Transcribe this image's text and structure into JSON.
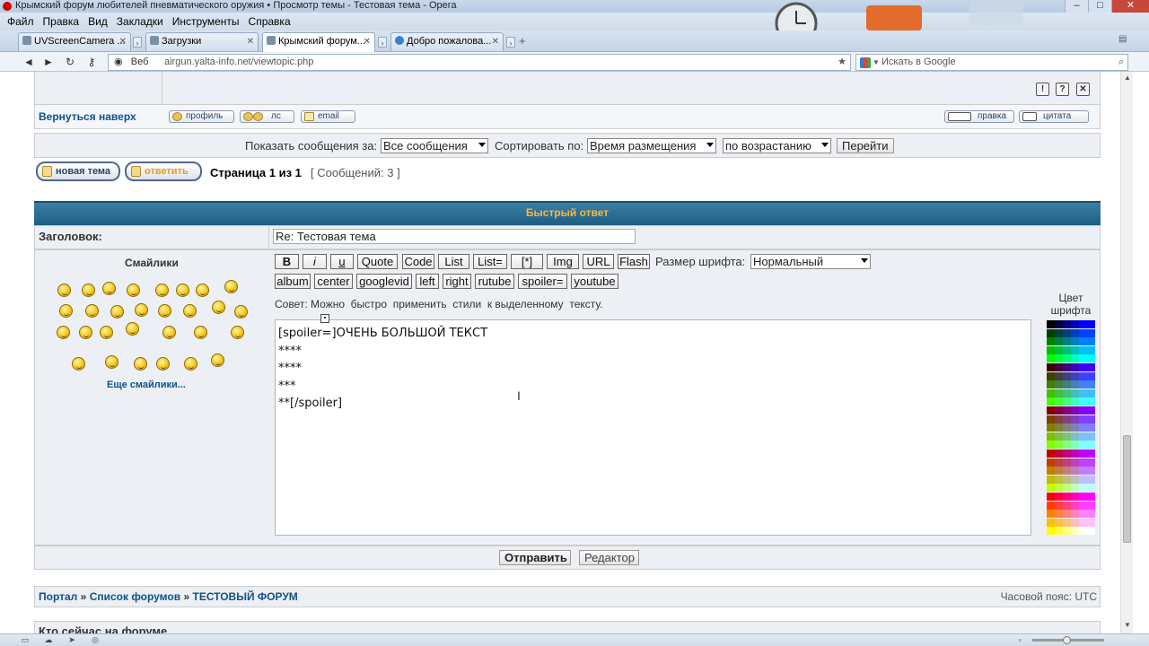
{
  "window": {
    "title": "Крымский форум любителей пневматического оружия • Просмотр темы - Тестовая тема - Opera",
    "controls": [
      "–",
      "□",
      "✕"
    ]
  },
  "menu": [
    "Файл",
    "Правка",
    "Вид",
    "Закладки",
    "Инструменты",
    "Справка"
  ],
  "tabs": [
    {
      "label": "UVScreenCamera ...",
      "active": false
    },
    {
      "label": "Загрузки",
      "active": false
    },
    {
      "label": "Крымский форум...",
      "active": true
    },
    {
      "label": "Добро пожалова...",
      "active": false
    }
  ],
  "address": {
    "web_label": "Веб",
    "url_domain": "airgun.yalta-info.net",
    "url_path": "/viewtopic.php",
    "search_placeholder": "Искать в Google"
  },
  "post_actions": {
    "back_to_top": "Вернуться наверх",
    "profile": "профиль",
    "pm": "лс",
    "email": "email",
    "edit": "правка",
    "quote": "цитата",
    "icons": [
      "!",
      "?",
      "✕"
    ]
  },
  "filter": {
    "show_label": "Показать сообщения за:",
    "show_value": "Все сообщения",
    "sort_label": "Сортировать по:",
    "sort_value": "Время размещения",
    "order_value": "по возрастанию",
    "go_button": "Перейти"
  },
  "pagination": {
    "new_topic": "новая тема",
    "reply": "ответить",
    "page_info": "Страница 1 из 1",
    "messages_info": "[ Сообщений: 3 ]"
  },
  "quick_reply": {
    "header": "Быстрый ответ",
    "subject_label": "Заголовок:",
    "subject_value": "Re: Тестовая  тема",
    "smilies_title": "Смайлики",
    "more_smilies": "Еще смайлики...",
    "buttons_row1": [
      "B",
      "i",
      "u",
      "Quote",
      "Code",
      "List",
      "List=",
      "[*]",
      "Img",
      "URL",
      "Flash"
    ],
    "font_size_label": "Размер шрифта:",
    "font_size_value": "Нормальный",
    "buttons_row2": [
      "album",
      "center",
      "googlevid",
      "left",
      "right",
      "rutube",
      "spoiler=",
      "youtube"
    ],
    "tip": "Совет: Можно  быстро  применить  стили  к выделенному  тексту.",
    "color_label_1": "Цвет",
    "color_label_2": "шрифта",
    "text_lines": [
      "[spoiler=]ОЧЕНЬ БОЛЬШОЙ ТЕКСТ",
      "****",
      "****",
      "***",
      "**[/spoiler]"
    ],
    "submit": "Отправить",
    "editor": "Редактор"
  },
  "footer": {
    "portal": "Портал",
    "forum_list": "Список форумов",
    "test_forum": "ТЕСТОВЫЙ ФОРУМ",
    "sep": "»",
    "timezone": "Часовой пояс: UTC",
    "who_online": "Кто сейчас на форуме"
  },
  "colors": {
    "header_bar": "#2c6e93",
    "header_text": "#ffb636",
    "link": "#105289",
    "row_bg": "#eceff3"
  }
}
